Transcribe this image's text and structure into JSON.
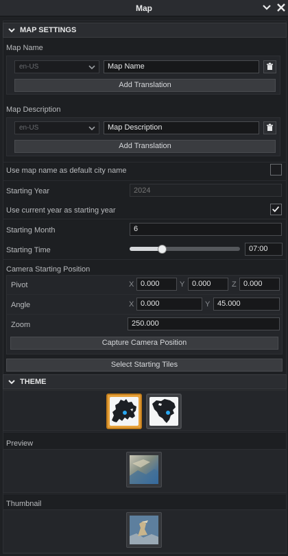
{
  "window": {
    "title": "Map"
  },
  "map_settings": {
    "header": "MAP SETTINGS",
    "map_name": {
      "label": "Map Name",
      "locale": "en-US",
      "value": "Map Name",
      "add_translation": "Add Translation"
    },
    "map_description": {
      "label": "Map Description",
      "locale": "en-US",
      "value": "Map Description",
      "add_translation": "Add Translation"
    },
    "use_map_name": {
      "label": "Use map name as default city name",
      "checked": false
    },
    "starting_year": {
      "label": "Starting Year",
      "placeholder": "2024"
    },
    "use_current_year": {
      "label": "Use current year as starting year",
      "checked": true
    },
    "starting_month": {
      "label": "Starting Month",
      "value": "6"
    },
    "starting_time": {
      "label": "Starting Time",
      "value": "07:00",
      "slider_fraction": 0.29
    },
    "camera": {
      "label": "Camera Starting Position",
      "pivot": {
        "label": "Pivot",
        "x_axis": "X",
        "y_axis": "Y",
        "z_axis": "Z",
        "x": "0.000",
        "y": "0.000",
        "z": "0.000"
      },
      "angle": {
        "label": "Angle",
        "x_axis": "X",
        "y_axis": "Y",
        "x": "0.000",
        "y": "45.000"
      },
      "zoom": {
        "label": "Zoom",
        "value": "250.000"
      },
      "capture_button": "Capture Camera Position"
    },
    "select_tiles_button": "Select Starting Tiles"
  },
  "theme": {
    "header": "THEME",
    "options": [
      {
        "icon": "europe-map-icon",
        "selected": true
      },
      {
        "icon": "north-america-map-icon",
        "selected": false
      }
    ],
    "preview_label": "Preview",
    "thumbnail_label": "Thumbnail"
  },
  "colors": {
    "accent": "#e7a13a",
    "background": "#1f2124",
    "dot": "#2aa8f2"
  }
}
